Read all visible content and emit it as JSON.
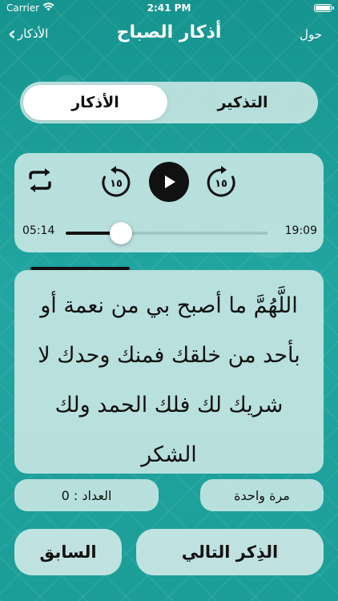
{
  "status": {
    "carrier": "Carrier",
    "time": "2:41 PM"
  },
  "nav": {
    "back_label": "الأذكار",
    "title": "أذكار الصباح",
    "about_label": "حول"
  },
  "segments": {
    "active": "الأذكار",
    "inactive": "التذكير"
  },
  "player": {
    "current_time": "05:14",
    "total_time": "19:09",
    "progress": 0.274,
    "skip_back_label": "١٥",
    "skip_forward_label": "١٥"
  },
  "reading_progress": 0.36,
  "dhikr": {
    "text": "اللَّهُمَّ ما أصبح بي من نعمة أو بأحد من خلقك فمنك وحدك لا شريك لك فلك الحمد ولك الشكر"
  },
  "counter": {
    "label": "العداد : 0"
  },
  "repeat": {
    "label": "مرة واحدة"
  },
  "buttons": {
    "prev_label": "السابق",
    "next_label": "الذِكر التالي"
  },
  "colors": {
    "background": "#1a9c98",
    "panel": "#cde8e6",
    "accent": "#111111"
  }
}
